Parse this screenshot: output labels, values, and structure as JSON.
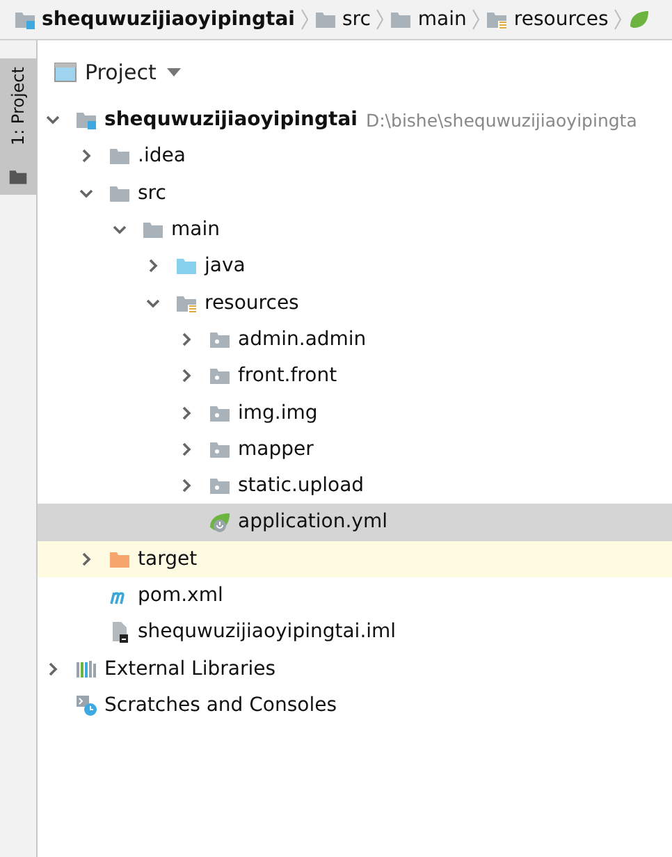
{
  "breadcrumbs": [
    {
      "label": "shequwuzijiaoyipingtai",
      "kind": "module"
    },
    {
      "label": "src",
      "kind": "folder"
    },
    {
      "label": "main",
      "kind": "folder"
    },
    {
      "label": "resources",
      "kind": "resources-folder"
    }
  ],
  "side_tab": {
    "label": "1: Project",
    "selected": true
  },
  "panel": {
    "title": "Project"
  },
  "tree": [
    {
      "label": "shequwuzijiaoyipingtai",
      "path": "D:\\bishe\\shequwuzijiaoyipingta",
      "kind": "module",
      "expanded": true,
      "selected": false,
      "children": [
        {
          "label": ".idea",
          "kind": "folder",
          "expanded": false,
          "selected": false
        },
        {
          "label": "src",
          "kind": "folder",
          "expanded": true,
          "selected": false,
          "children": [
            {
              "label": "main",
              "kind": "folder",
              "expanded": true,
              "selected": false,
              "children": [
                {
                  "label": "java",
                  "kind": "source-folder",
                  "expanded": false,
                  "selected": false
                },
                {
                  "label": "resources",
                  "kind": "resources-folder",
                  "expanded": true,
                  "selected": false,
                  "children": [
                    {
                      "label": "admin.admin",
                      "kind": "package",
                      "expanded": false,
                      "selected": false
                    },
                    {
                      "label": "front.front",
                      "kind": "package",
                      "expanded": false,
                      "selected": false
                    },
                    {
                      "label": "img.img",
                      "kind": "package",
                      "expanded": false,
                      "selected": false
                    },
                    {
                      "label": "mapper",
                      "kind": "package",
                      "expanded": false,
                      "selected": false
                    },
                    {
                      "label": "static.upload",
                      "kind": "package",
                      "expanded": false,
                      "selected": false
                    },
                    {
                      "label": "application.yml",
                      "kind": "spring-file",
                      "selected": true
                    }
                  ]
                }
              ]
            }
          ]
        },
        {
          "label": "target",
          "kind": "excluded-folder",
          "expanded": false,
          "selected": false
        },
        {
          "label": "pom.xml",
          "kind": "maven-file",
          "selected": false
        },
        {
          "label": "shequwuzijiaoyipingtai.iml",
          "kind": "iml-file",
          "selected": false
        }
      ]
    },
    {
      "label": "External Libraries",
      "kind": "libraries",
      "expanded": false,
      "selected": false
    },
    {
      "label": "Scratches and Consoles",
      "kind": "scratches",
      "selected": false
    }
  ]
}
